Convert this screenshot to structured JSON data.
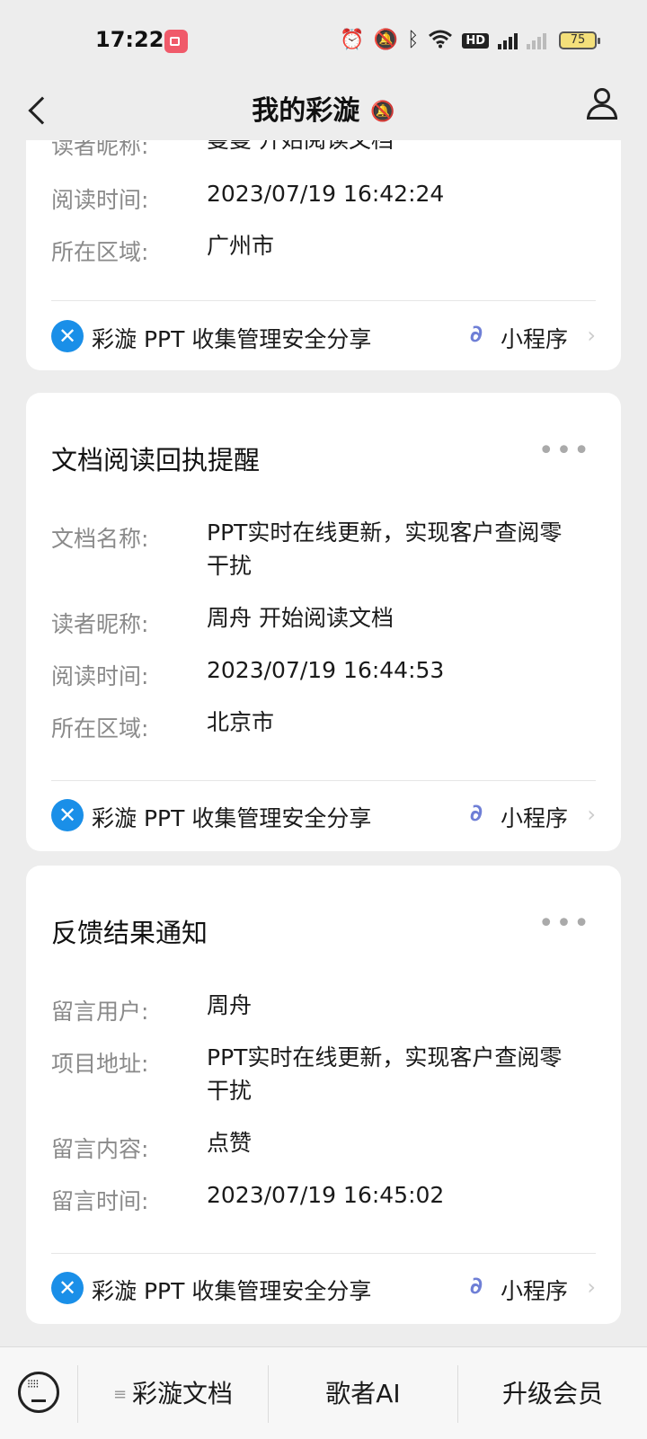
{
  "status": {
    "time": "17:22",
    "hd": "HD",
    "battery": "75",
    "icons": [
      "alarm-icon",
      "bell-off-icon",
      "bluetooth-icon",
      "wifi-icon",
      "hd-icon",
      "signal-5g-icon",
      "signal-icon",
      "battery-icon"
    ]
  },
  "header": {
    "title": "我的彩漩",
    "back_icon": "back-icon",
    "mute_icon": "bell-off-icon",
    "user_icon": "user-icon"
  },
  "cards": [
    {
      "rows": [
        {
          "label": "读者昵称:",
          "value": "曼曼 开始阅读文档"
        },
        {
          "label": "阅读时间:",
          "value": "2023/07/19 16:42:24"
        },
        {
          "label": "所在区域:",
          "value": "广州市"
        }
      ],
      "footer": {
        "app_name": "彩漩 PPT 收集管理安全分享",
        "mini_program": "小程序"
      }
    },
    {
      "title": "文档阅读回执提醒",
      "rows": [
        {
          "label": "文档名称:",
          "value": "PPT实时在线更新，实现客户查阅零干扰"
        },
        {
          "label": "读者昵称:",
          "value": "周舟 开始阅读文档"
        },
        {
          "label": "阅读时间:",
          "value": "2023/07/19 16:44:53"
        },
        {
          "label": "所在区域:",
          "value": "北京市"
        }
      ],
      "footer": {
        "app_name": "彩漩 PPT 收集管理安全分享",
        "mini_program": "小程序"
      }
    },
    {
      "title": "反馈结果通知",
      "rows": [
        {
          "label": "留言用户:",
          "value": "周舟"
        },
        {
          "label": "项目地址:",
          "value": "PPT实时在线更新，实现客户查阅零干扰"
        },
        {
          "label": "留言内容:",
          "value": "点赞"
        },
        {
          "label": "留言时间:",
          "value": "2023/07/19 16:45:02"
        }
      ],
      "footer": {
        "app_name": "彩漩 PPT 收集管理安全分享",
        "mini_program": "小程序"
      }
    }
  ],
  "bottom_bar": {
    "keyboard_icon": "keyboard-icon",
    "tabs": [
      {
        "label": "彩漩文档",
        "has_menu_icon": true
      },
      {
        "label": "歌者AI"
      },
      {
        "label": "升级会员"
      }
    ]
  },
  "colors": {
    "background": "#ededed",
    "card": "#ffffff",
    "label": "#8a8a8a",
    "app_logo": "#1a8fe8",
    "mini_program_icon": "#6f7fd6"
  }
}
